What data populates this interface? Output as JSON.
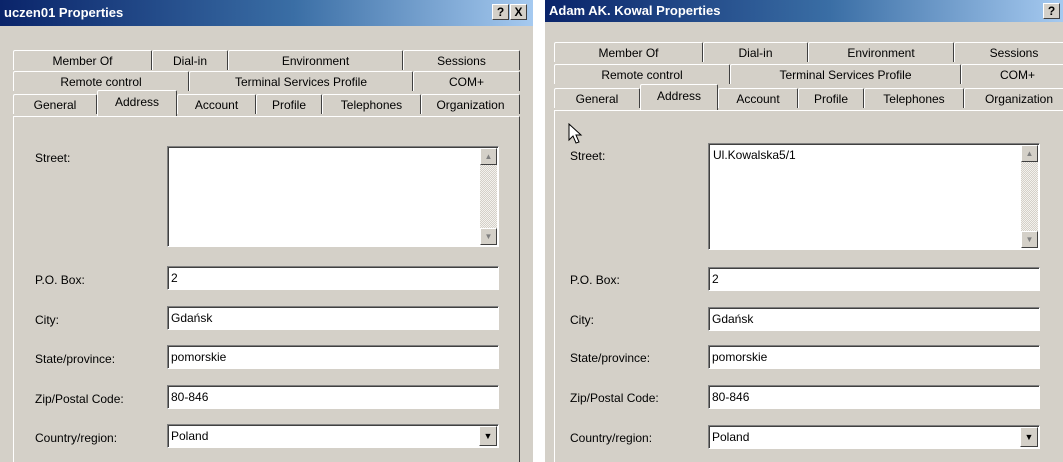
{
  "windows": [
    {
      "title": "uczen01 Properties",
      "controls": {
        "help": "?",
        "close": "X"
      },
      "tabs": {
        "row1": [
          "Member Of",
          "Dial-in",
          "Environment",
          "Sessions"
        ],
        "row2": [
          "Remote control",
          "Terminal Services Profile",
          "COM+"
        ],
        "row3": [
          "General",
          "Address",
          "Account",
          "Profile",
          "Telephones",
          "Organization"
        ]
      },
      "active_tab": "Address",
      "form": {
        "street_label": "Street:",
        "street_value": "",
        "pobox_label": "P.O. Box:",
        "pobox_value": "2",
        "city_label": "City:",
        "city_value": "Gdańsk",
        "state_label": "State/province:",
        "state_value": "pomorskie",
        "zip_label": "Zip/Postal Code:",
        "zip_value": "80-846",
        "country_label": "Country/region:",
        "country_value": "Poland"
      }
    },
    {
      "title": "Adam AK. Kowal Properties",
      "controls": {
        "help": "?"
      },
      "tabs": {
        "row1": [
          "Member Of",
          "Dial-in",
          "Environment",
          "Sessions"
        ],
        "row2": [
          "Remote control",
          "Terminal Services Profile",
          "COM+"
        ],
        "row3": [
          "General",
          "Address",
          "Account",
          "Profile",
          "Telephones",
          "Organization"
        ]
      },
      "active_tab": "Address",
      "form": {
        "street_label": "Street:",
        "street_value": "Ul.Kowalska5/1",
        "pobox_label": "P.O. Box:",
        "pobox_value": "2",
        "city_label": "City:",
        "city_value": "Gdańsk",
        "state_label": "State/province:",
        "state_value": "pomorskie",
        "zip_label": "Zip/Postal Code:",
        "zip_value": "80-846",
        "country_label": "Country/region:",
        "country_value": "Poland"
      }
    }
  ],
  "icons": {
    "scroll_up": "▲",
    "scroll_down": "▼",
    "dropdown": "▼",
    "colors": {
      "face": "#d4d0c8",
      "title_start": "#0a246a",
      "title_end": "#a6caf0"
    }
  }
}
